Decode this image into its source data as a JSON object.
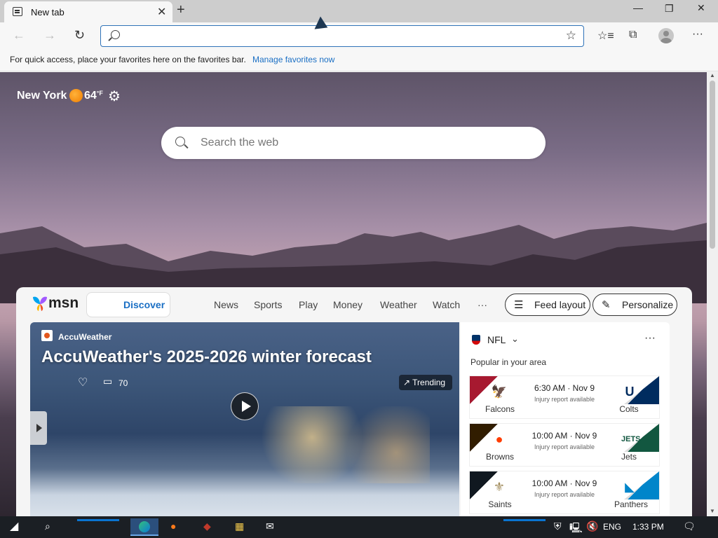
{
  "tab": {
    "title": "New tab",
    "close": "✕",
    "new_tab": "+"
  },
  "window": {
    "minimize": "—",
    "restore": "❐",
    "close": "✕"
  },
  "toolbar": {
    "back": "←",
    "forward": "→",
    "reload": "↻",
    "address_value": "",
    "favorite": "☆",
    "favorites": "☆≡",
    "collections": "⧉",
    "more": "···"
  },
  "favbar": {
    "message": "For quick access, place your favorites here on the favorites bar.",
    "link": "Manage favorites now"
  },
  "weather": {
    "city": "New York",
    "temperature": "64",
    "unit": "°F",
    "settings": "⚙"
  },
  "search": {
    "placeholder": "Search the web"
  },
  "msn": {
    "logo": "msn",
    "discover": "Discover",
    "nav": [
      "News",
      "Sports",
      "Play",
      "Money",
      "Weather",
      "Watch",
      "···"
    ],
    "feed_layout": "Feed layout",
    "personalize": "Personalize",
    "hero": {
      "source": "AccuWeather",
      "headline": "AccuWeather's 2025-2026 winter forecast",
      "comments": "70",
      "trending": "↗ Trending"
    },
    "nfl": {
      "title": "NFL",
      "more": "···",
      "popular": "Popular in your area",
      "games": [
        {
          "home": "Falcons",
          "away": "Colts",
          "time": "6:30 AM · Nov 9",
          "status": "Injury report available",
          "home_color": "#a71930",
          "away_color": "#002c5f"
        },
        {
          "home": "Browns",
          "away": "Jets",
          "time": "10:00 AM · Nov 9",
          "status": "Injury report available",
          "home_color": "#311d00",
          "away_color": "#125740"
        },
        {
          "home": "Saints",
          "away": "Panthers",
          "time": "10:00 AM · Nov 9",
          "status": "Injury report available",
          "home_color": "#101820",
          "away_color": "#0085ca"
        }
      ]
    }
  },
  "taskbar": {
    "language": "ENG",
    "time": "1:33 PM"
  }
}
